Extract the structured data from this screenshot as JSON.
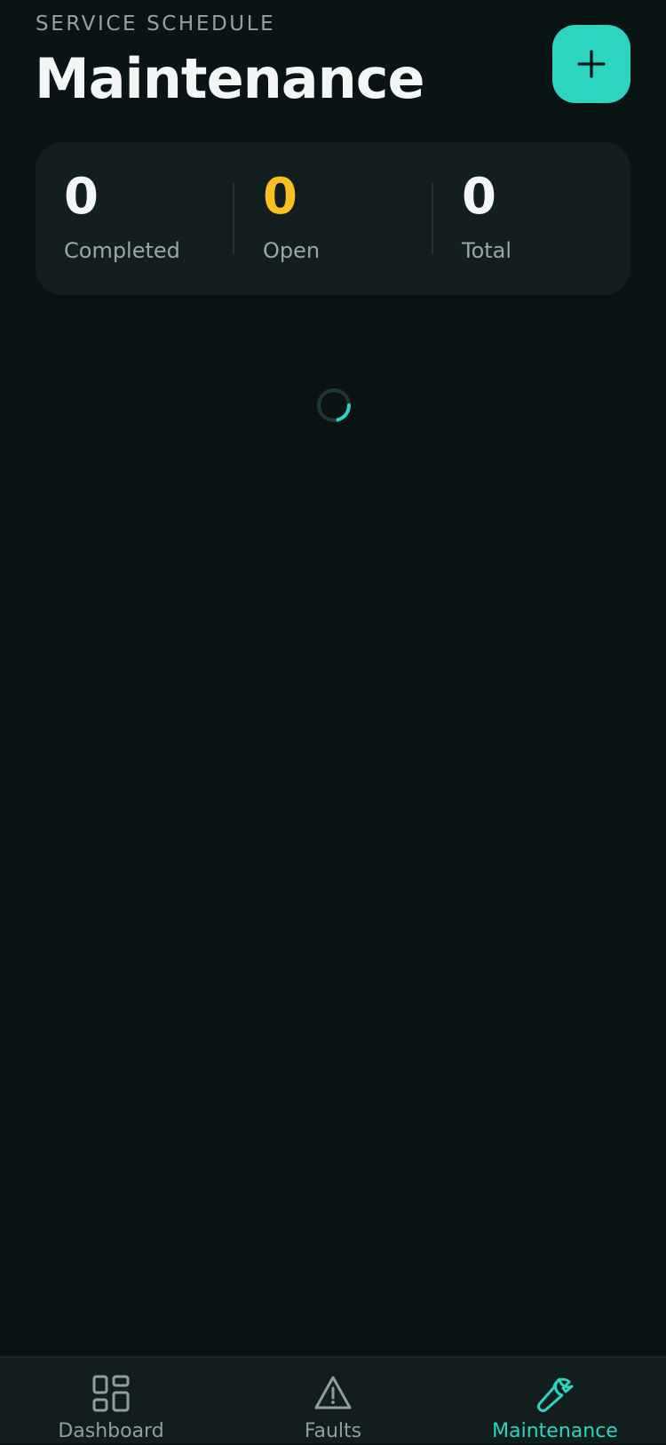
{
  "header": {
    "eyebrow": "SERVICE SCHEDULE",
    "title": "Maintenance",
    "add_button_icon": "plus-icon"
  },
  "stats": [
    {
      "value": "0",
      "label": "Completed",
      "color": "#f2f6f6"
    },
    {
      "value": "0",
      "label": "Open",
      "color": "#fbbf24"
    },
    {
      "value": "0",
      "label": "Total",
      "color": "#f2f6f6"
    }
  ],
  "loading": {
    "icon": "loading-spinner-icon",
    "accent": "#2dd4bf"
  },
  "nav": {
    "active": "Maintenance",
    "items": [
      {
        "label": "Dashboard",
        "icon": "dashboard-grid-icon"
      },
      {
        "label": "Faults",
        "icon": "warning-triangle-icon"
      },
      {
        "label": "Maintenance",
        "icon": "wrench-icon"
      }
    ]
  },
  "colors": {
    "background": "#0b1414",
    "card": "#131f1f",
    "accent": "#2dd4bf",
    "warning": "#fbbf24"
  }
}
